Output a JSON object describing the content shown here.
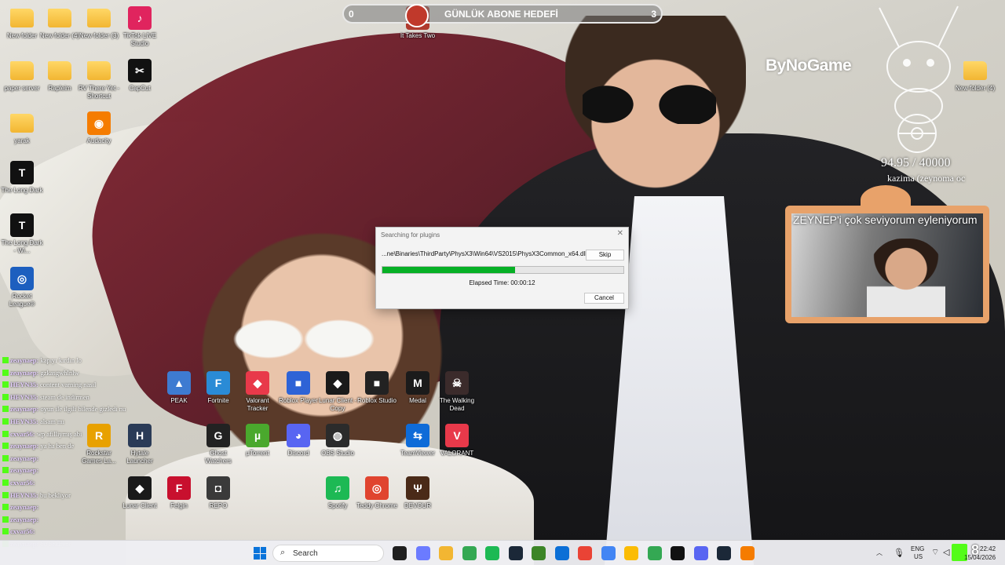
{
  "desktop": {
    "icons": [
      {
        "label": "New folder",
        "glyph": "",
        "kind": "folder"
      },
      {
        "label": "New folder (4)",
        "glyph": "",
        "kind": "folder"
      },
      {
        "label": "New folder (3)",
        "glyph": "",
        "kind": "folder"
      },
      {
        "label": "TikTok LIVE Studio",
        "glyph": "♪",
        "color": "#e0245e"
      },
      {
        "label": "paper server",
        "glyph": "",
        "kind": "folder"
      },
      {
        "label": "Rapleim",
        "glyph": "",
        "kind": "folder"
      },
      {
        "label": "RV There Yet - Shortcut",
        "glyph": "",
        "kind": "folder"
      },
      {
        "label": "CapCut",
        "glyph": "✂",
        "color": "#111111"
      },
      {
        "label": "yarak",
        "glyph": "",
        "kind": "folder"
      },
      {
        "label": "Audacity",
        "glyph": "◉",
        "color": "#f57c00"
      },
      {
        "label": "The Long Dark",
        "glyph": "T",
        "color": "#111111"
      },
      {
        "label": "The Long Dark - Wi...",
        "glyph": "T",
        "color": "#111111"
      },
      {
        "label": "Rocket League®",
        "glyph": "◎",
        "color": "#1d5fbf"
      },
      {
        "label": "PEAK",
        "glyph": "▲",
        "color": "#3e7bd1"
      },
      {
        "label": "Fortnite",
        "glyph": "F",
        "color": "#2a8bd6"
      },
      {
        "label": "Valorant Tracker",
        "glyph": "◆",
        "color": "#e8394a"
      },
      {
        "label": "Roblox Player",
        "glyph": "■",
        "color": "#2e63d6"
      },
      {
        "label": "Lunar Client - Copy",
        "glyph": "◆",
        "color": "#1a1a1a"
      },
      {
        "label": "Roblox Studio",
        "glyph": "■",
        "color": "#222222"
      },
      {
        "label": "Medal",
        "glyph": "M",
        "color": "#1b1b1b"
      },
      {
        "label": "The Walking Dead",
        "glyph": "☠",
        "color": "#3b2b2b"
      },
      {
        "label": "Rockstar Games La...",
        "glyph": "R",
        "color": "#e8a100"
      },
      {
        "label": "Hytale Launcher",
        "glyph": "H",
        "color": "#2a3b57"
      },
      {
        "label": "Ghost Watchers",
        "glyph": "G",
        "color": "#222222"
      },
      {
        "label": "µTorrent",
        "glyph": "µ",
        "color": "#4aa82d"
      },
      {
        "label": "Discord",
        "glyph": "◕",
        "color": "#5865f2"
      },
      {
        "label": "OBS Studio",
        "glyph": "◍",
        "color": "#2b2b2b"
      },
      {
        "label": "TeamViewer",
        "glyph": "⇆",
        "color": "#0e6bd8"
      },
      {
        "label": "VALORANT",
        "glyph": "V",
        "color": "#e8394a"
      },
      {
        "label": "Lunar Client",
        "glyph": "◆",
        "color": "#1a1a1a"
      },
      {
        "label": "Felgin",
        "glyph": "F",
        "color": "#c8102e"
      },
      {
        "label": "REPO",
        "glyph": "◘",
        "color": "#3a3a3a"
      },
      {
        "label": "Spotify",
        "glyph": "♫",
        "color": "#1db954"
      },
      {
        "label": "Teddy Chrome",
        "glyph": "◎",
        "color": "#e0442f"
      },
      {
        "label": "DEVOUR",
        "glyph": "Ψ",
        "color": "#4a2a18"
      },
      {
        "label": "New folder (4)",
        "glyph": "",
        "kind": "folder"
      },
      {
        "label": "It Takes Two",
        "glyph": "♥",
        "color": "#b03a2e"
      }
    ]
  },
  "overlay": {
    "goal_left": "0",
    "goal_title": "GÜNLÜK ABONE HEDEFİ",
    "goal_right": "3",
    "sponsor": "ByNoGame",
    "counter": "94.95 / 40000",
    "counter_sub": "kazima (zeynoma oc",
    "cam_caption": "ZEYNEP'i çok seviyorum eyleniyorum"
  },
  "dialog": {
    "title": "Searching for plugins",
    "close": "✕",
    "path": "...ne\\Binaries\\ThirdParty\\PhysX3\\Win64\\VS2015\\PhysX3Common_x64.dll",
    "skip": "Skip",
    "progress": 0.55,
    "elapsed": "Elapsed Time: 00:00:12",
    "cancel": "Cancel"
  },
  "chat": [
    {
      "user": "zeaynaep:",
      "text": "kapıyı kırdın lo"
    },
    {
      "user": "zeaynaep:",
      "text": "gzkasgwhlnlw"
    },
    {
      "user": "HEYN35:",
      "text": "content varning nasıl"
    },
    {
      "user": "HEYN35:",
      "text": "steam de indirmen"
    },
    {
      "user": "zeaynaep:",
      "text": "oyun ile ilgili bilende gizledi nu"
    },
    {
      "user": "HEYN35:",
      "text": "alsam mı"
    },
    {
      "user": "cxvar56:",
      "text": "wp afilliymış abi"
    },
    {
      "user": "zeaynaep:",
      "text": "ya ha ben de"
    },
    {
      "user": "zeaynaep:",
      "text": ""
    },
    {
      "user": "zeaynaep:",
      "text": ""
    },
    {
      "user": "cxvar56:",
      "text": ""
    },
    {
      "user": "HEYN35:",
      "text": "bu bekliyor"
    },
    {
      "user": "zeaynaep:",
      "text": ""
    },
    {
      "user": "zeaynaep:",
      "text": ""
    },
    {
      "user": "cxvar56:",
      "text": ""
    },
    {
      "user": "zeaynaep:",
      "text": "bu bekliyor"
    }
  ],
  "taskbar": {
    "search_label": "Search",
    "lang_top": "ENG",
    "lang_bottom": "US",
    "time": "22:42",
    "date": "15/04/2026",
    "notif_count": "8",
    "apps": [
      {
        "name": "file-explorer",
        "color": "#1f1f1f"
      },
      {
        "name": "copilot",
        "color": "#6b7bff"
      },
      {
        "name": "folder",
        "color": "#f2b632"
      },
      {
        "name": "chrome",
        "color": "#34a853"
      },
      {
        "name": "spotify",
        "color": "#1db954"
      },
      {
        "name": "steam",
        "color": "#1b2838"
      },
      {
        "name": "minecraft",
        "color": "#3c8527"
      },
      {
        "name": "photos",
        "color": "#0b6fd6"
      },
      {
        "name": "chrome-2",
        "color": "#ea4335"
      },
      {
        "name": "chrome-3",
        "color": "#4285f4"
      },
      {
        "name": "chrome-4",
        "color": "#fbbc05"
      },
      {
        "name": "chrome-5",
        "color": "#34a853"
      },
      {
        "name": "tiktok",
        "color": "#111111"
      },
      {
        "name": "discord",
        "color": "#5865f2"
      },
      {
        "name": "steam-2",
        "color": "#1b2838"
      },
      {
        "name": "app-orange",
        "color": "#f57c00"
      }
    ]
  }
}
